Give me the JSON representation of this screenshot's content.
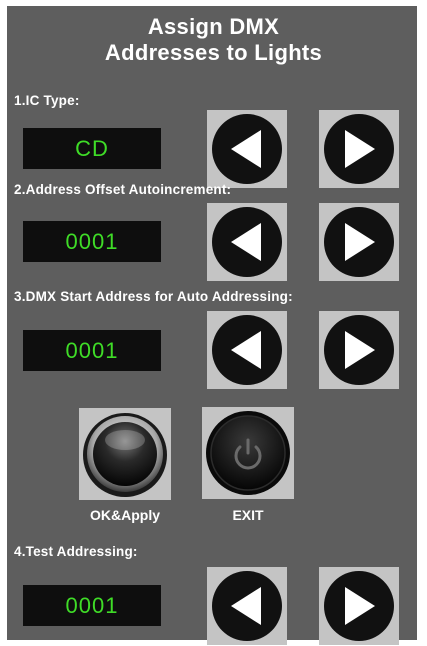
{
  "title_line1": "Assign DMX",
  "title_line2": "Addresses to Lights",
  "sections": {
    "ic_type": {
      "label": "1.IC Type:",
      "value": "CD"
    },
    "offset": {
      "label": "2.Address Offset Autoincrement:",
      "value": "0001"
    },
    "start": {
      "label": "3.DMX Start Address for Auto Addressing:",
      "value": "0001"
    },
    "test": {
      "label": "4.Test Addressing:",
      "value": "0001"
    }
  },
  "buttons": {
    "ok_label": "OK&Apply",
    "exit_label": "EXIT"
  },
  "colors": {
    "panel": "#5e5e5e",
    "display_bg": "#0e0e0e",
    "display_text": "#3fdc27",
    "button_bg": "#c4c4c4"
  },
  "icons": [
    "left-arrow-icon",
    "right-arrow-icon",
    "power-icon"
  ]
}
